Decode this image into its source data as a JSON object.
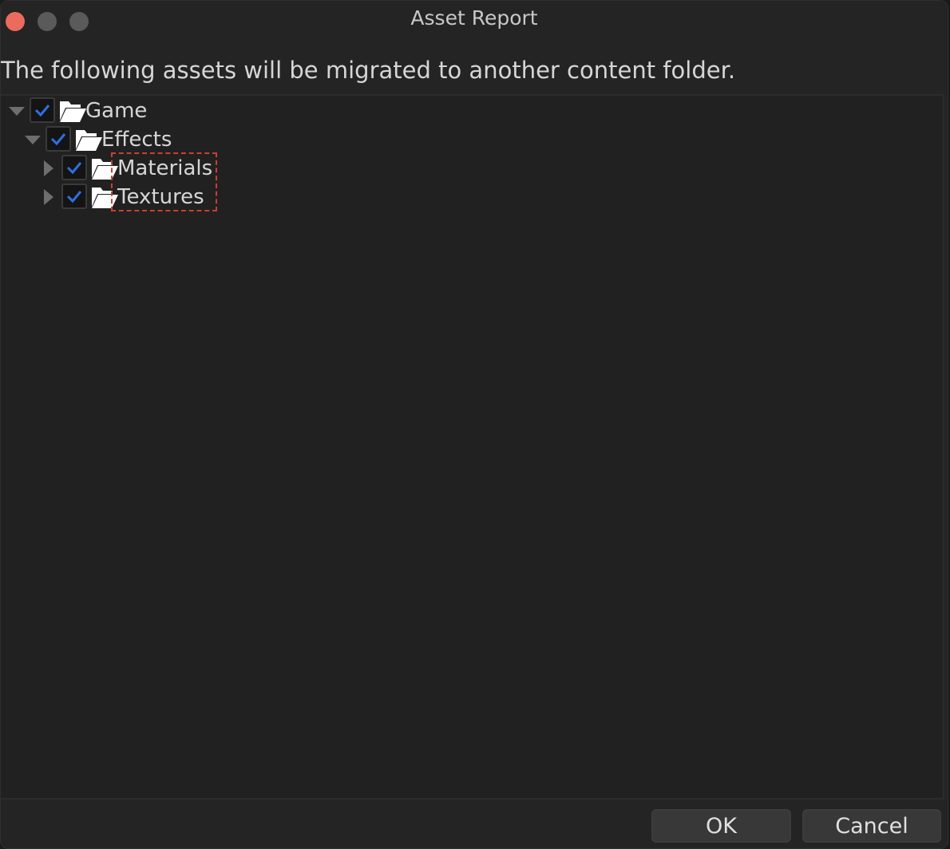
{
  "window": {
    "title": "Asset Report"
  },
  "description": "The following assets will be migrated to another content folder.",
  "tree": {
    "items": [
      {
        "label": "Game",
        "checked": true,
        "expanded": true,
        "depth": 0
      },
      {
        "label": "Effects",
        "checked": true,
        "expanded": true,
        "depth": 1
      },
      {
        "label": "Materials",
        "checked": true,
        "expanded": false,
        "depth": 2
      },
      {
        "label": "Textures",
        "checked": true,
        "expanded": false,
        "depth": 2
      }
    ]
  },
  "buttons": {
    "ok_label": "OK",
    "cancel_label": "Cancel"
  },
  "colors": {
    "close_button": "#ec6a5e",
    "checkmark": "#2f6fe0",
    "annotation": "#c8412f"
  }
}
